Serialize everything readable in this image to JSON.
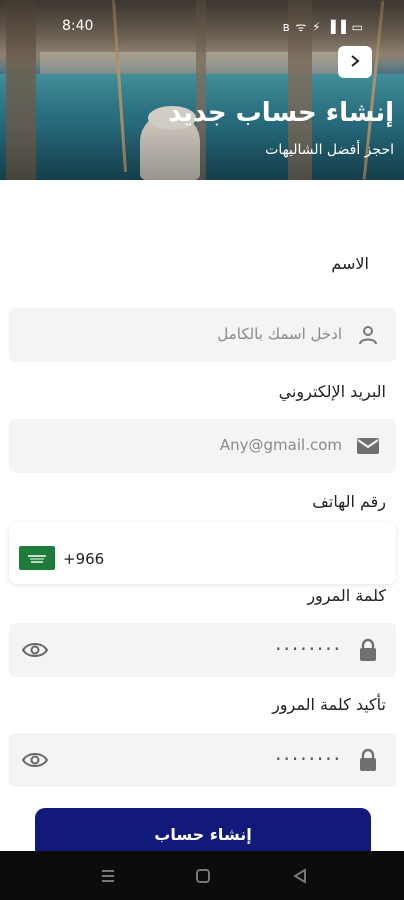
{
  "status_bar": {
    "time": "8:40",
    "icons_text": "ʙ ᯤ ⚡ ▐▐ ▭"
  },
  "header": {
    "back_icon": "chevron-right-icon",
    "title": "إنشاء حساب جديد",
    "subtitle": "احجز أفضل الشاليهات"
  },
  "form": {
    "name": {
      "label": "الاسم",
      "placeholder": "ادخل اسمك بالكامل",
      "icon": "person-icon"
    },
    "email": {
      "label": "البريد الإلكتروني",
      "placeholder": "Any@gmail.com",
      "icon": "mail-icon"
    },
    "phone": {
      "label": "رقم الهاتف",
      "country_code": "+966",
      "flag": "saudi-flag-icon"
    },
    "password": {
      "label": "كلمة المرور",
      "value": "········",
      "icon": "lock-icon",
      "toggle_icon": "eye-icon"
    },
    "confirm_password": {
      "label": "تأكيد كلمة المرور",
      "value": "········",
      "icon": "lock-icon",
      "toggle_icon": "eye-icon"
    },
    "submit_label": "إنشاء حساب"
  },
  "colors": {
    "primary": "#111a7a",
    "field_bg": "#f4f4f4",
    "flag_green": "#1e7b3a"
  },
  "nav_bar": {
    "buttons": [
      "menu-icon",
      "home-icon",
      "back-icon"
    ]
  }
}
